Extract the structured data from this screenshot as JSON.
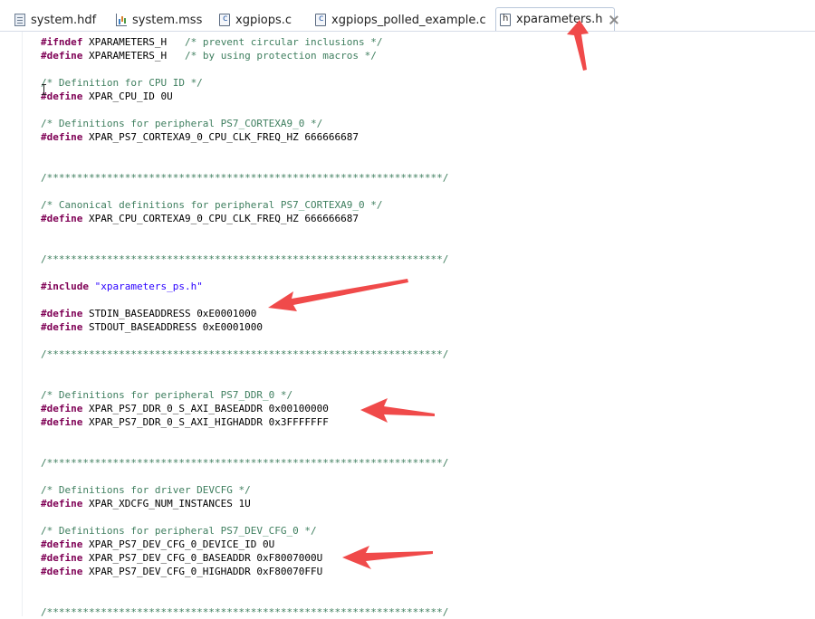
{
  "tabs": [
    {
      "label": "system.hdf",
      "icon": "hdf-file-icon"
    },
    {
      "label": "system.mss",
      "icon": "mss-file-icon"
    },
    {
      "label": "xgpiops.c",
      "icon": "c-file-icon"
    },
    {
      "label": "xgpiops_polled_example.c",
      "icon": "c-file-icon"
    },
    {
      "label": "xparameters.h",
      "icon": "h-file-icon",
      "active": true
    }
  ],
  "code": [
    {
      "seg": [
        {
          "c": "kw",
          "t": "#ifndef"
        },
        {
          "c": "plain",
          "t": " XPARAMETERS_H   "
        },
        {
          "c": "comment",
          "t": "/* prevent circular inclusions */"
        }
      ]
    },
    {
      "seg": [
        {
          "c": "kw",
          "t": "#define"
        },
        {
          "c": "plain",
          "t": " XPARAMETERS_H   "
        },
        {
          "c": "comment",
          "t": "/* by using protection macros */"
        }
      ]
    },
    {
      "seg": []
    },
    {
      "seg": [
        {
          "c": "comment",
          "t": "/* Definition for CPU ID */"
        }
      ]
    },
    {
      "seg": [
        {
          "c": "kw",
          "t": "#define"
        },
        {
          "c": "plain",
          "t": " XPAR_CPU_ID 0U"
        }
      ]
    },
    {
      "seg": []
    },
    {
      "seg": [
        {
          "c": "comment",
          "t": "/* Definitions for peripheral PS7_CORTEXA9_0 */"
        }
      ]
    },
    {
      "seg": [
        {
          "c": "kw",
          "t": "#define"
        },
        {
          "c": "plain",
          "t": " XPAR_PS7_CORTEXA9_0_CPU_CLK_FREQ_HZ 666666687"
        }
      ]
    },
    {
      "seg": []
    },
    {
      "seg": []
    },
    {
      "seg": [
        {
          "c": "comment",
          "t": "/******************************************************************/"
        }
      ]
    },
    {
      "seg": []
    },
    {
      "seg": [
        {
          "c": "comment",
          "t": "/* Canonical definitions for peripheral PS7_CORTEXA9_0 */"
        }
      ]
    },
    {
      "seg": [
        {
          "c": "kw",
          "t": "#define"
        },
        {
          "c": "plain",
          "t": " XPAR_CPU_CORTEXA9_0_CPU_CLK_FREQ_HZ 666666687"
        }
      ]
    },
    {
      "seg": []
    },
    {
      "seg": []
    },
    {
      "seg": [
        {
          "c": "comment",
          "t": "/******************************************************************/"
        }
      ]
    },
    {
      "seg": []
    },
    {
      "seg": [
        {
          "c": "kw",
          "t": "#include"
        },
        {
          "c": "plain",
          "t": " "
        },
        {
          "c": "str",
          "t": "\"xparameters_ps.h\""
        }
      ]
    },
    {
      "seg": []
    },
    {
      "seg": [
        {
          "c": "kw",
          "t": "#define"
        },
        {
          "c": "plain",
          "t": " STDIN_BASEADDRESS 0xE0001000"
        }
      ]
    },
    {
      "seg": [
        {
          "c": "kw",
          "t": "#define"
        },
        {
          "c": "plain",
          "t": " STDOUT_BASEADDRESS 0xE0001000"
        }
      ]
    },
    {
      "seg": []
    },
    {
      "seg": [
        {
          "c": "comment",
          "t": "/******************************************************************/"
        }
      ]
    },
    {
      "seg": []
    },
    {
      "seg": []
    },
    {
      "seg": [
        {
          "c": "comment",
          "t": "/* Definitions for peripheral PS7_DDR_0 */"
        }
      ]
    },
    {
      "seg": [
        {
          "c": "kw",
          "t": "#define"
        },
        {
          "c": "plain",
          "t": " XPAR_PS7_DDR_0_S_AXI_BASEADDR 0x00100000"
        }
      ]
    },
    {
      "seg": [
        {
          "c": "kw",
          "t": "#define"
        },
        {
          "c": "plain",
          "t": " XPAR_PS7_DDR_0_S_AXI_HIGHADDR 0x3FFFFFFF"
        }
      ]
    },
    {
      "seg": []
    },
    {
      "seg": []
    },
    {
      "seg": [
        {
          "c": "comment",
          "t": "/******************************************************************/"
        }
      ]
    },
    {
      "seg": []
    },
    {
      "seg": [
        {
          "c": "comment",
          "t": "/* Definitions for driver DEVCFG */"
        }
      ]
    },
    {
      "seg": [
        {
          "c": "kw",
          "t": "#define"
        },
        {
          "c": "plain",
          "t": " XPAR_XDCFG_NUM_INSTANCES 1U"
        }
      ]
    },
    {
      "seg": []
    },
    {
      "seg": [
        {
          "c": "comment",
          "t": "/* Definitions for peripheral PS7_DEV_CFG_0 */"
        }
      ]
    },
    {
      "seg": [
        {
          "c": "kw",
          "t": "#define"
        },
        {
          "c": "plain",
          "t": " XPAR_PS7_DEV_CFG_0_DEVICE_ID 0U"
        }
      ]
    },
    {
      "seg": [
        {
          "c": "kw",
          "t": "#define"
        },
        {
          "c": "plain",
          "t": " XPAR_PS7_DEV_CFG_0_BASEADDR 0xF8007000U"
        }
      ]
    },
    {
      "seg": [
        {
          "c": "kw",
          "t": "#define"
        },
        {
          "c": "plain",
          "t": " XPAR_PS7_DEV_CFG_0_HIGHADDR 0xF80070FFU"
        }
      ]
    },
    {
      "seg": []
    },
    {
      "seg": []
    },
    {
      "seg": [
        {
          "c": "comment",
          "t": "/******************************************************************/"
        }
      ]
    }
  ],
  "colors": {
    "keyword": "#7f0055",
    "comment": "#3f7f5f",
    "string": "#2a00ff",
    "annotation_arrow": "#f04a4a"
  }
}
